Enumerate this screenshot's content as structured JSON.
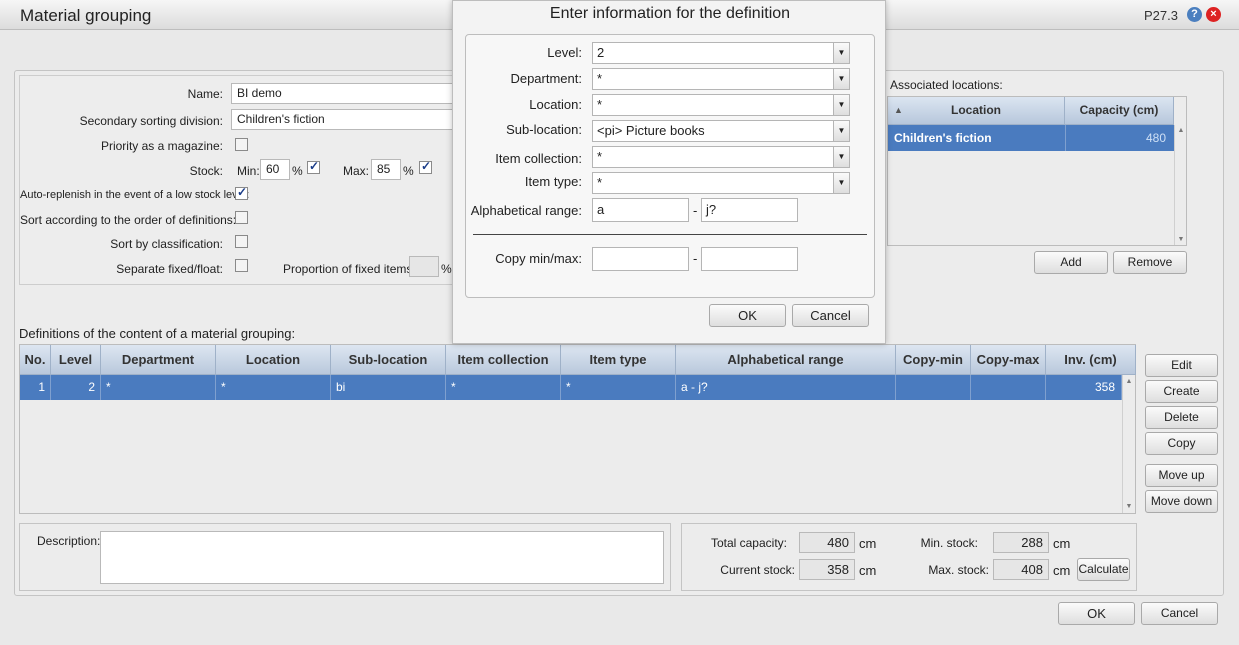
{
  "window": {
    "title": "Material grouping",
    "version": "P27.3",
    "help": "?",
    "close": "×"
  },
  "form": {
    "name_label": "Name:",
    "name_value": "BI demo",
    "secondary_label": "Secondary sorting division:",
    "secondary_value": "Children's fiction",
    "priority_label": "Priority as a magazine:",
    "priority_checked": false,
    "stock_label": "Stock:",
    "min_label": "Min:",
    "min_value": "60",
    "pct1": "%",
    "min_checked": true,
    "max_label": "Max:",
    "max_value": "85",
    "pct2": "%",
    "max_checked": true,
    "autoreplenish_label": "Auto-replenish in the event of a low stock level:",
    "autoreplenish_checked": true,
    "sort_order_label": "Sort according to the order of definitions:",
    "sort_order_checked": false,
    "sort_class_label": "Sort by classification:",
    "sort_class_checked": false,
    "separate_label": "Separate fixed/float:",
    "separate_checked": false,
    "proportion_label": "Proportion of fixed items:",
    "proportion_value": "",
    "pct3": "%"
  },
  "locations": {
    "label": "Associated locations:",
    "columns": [
      "Location",
      "Capacity (cm)"
    ],
    "rows": [
      {
        "location": "Children's fiction",
        "capacity": "480"
      }
    ],
    "add_label": "Add",
    "remove_label": "Remove"
  },
  "definitions": {
    "label": "Definitions of the content of a material grouping:",
    "columns": [
      "No.",
      "Level",
      "Department",
      "Location",
      "Sub-location",
      "Item collection",
      "Item type",
      "Alphabetical range",
      "Copy-min",
      "Copy-max",
      "Inv. (cm)"
    ],
    "rows": [
      {
        "no": "1",
        "level": "2",
        "department": "*",
        "location": "*",
        "sublocation": "bi",
        "collection": "*",
        "itemtype": "*",
        "range": "a - j?",
        "copymin": "",
        "copymax": "",
        "inv": "358"
      }
    ],
    "buttons": {
      "edit": "Edit",
      "create": "Create",
      "delete": "Delete",
      "copy": "Copy",
      "move_up": "Move up",
      "move_down": "Move down"
    }
  },
  "description": {
    "label": "Description:",
    "value": ""
  },
  "stock": {
    "total_capacity_label": "Total capacity:",
    "total_capacity": "480",
    "current_stock_label": "Current stock:",
    "current_stock": "358",
    "min_stock_label": "Min. stock:",
    "min_stock": "288",
    "max_stock_label": "Max. stock:",
    "max_stock": "408",
    "unit": "cm",
    "calculate_label": "Calculate"
  },
  "footer": {
    "ok": "OK",
    "cancel": "Cancel"
  },
  "dialog": {
    "title": "Enter information for the definition",
    "level_label": "Level:",
    "level_value": "2",
    "department_label": "Department:",
    "department_value": "*",
    "location_label": "Location:",
    "location_value": "*",
    "sublocation_label": "Sub-location:",
    "sublocation_value": "<pi> Picture books",
    "collection_label": "Item collection:",
    "collection_value": "*",
    "itemtype_label": "Item type:",
    "itemtype_value": "*",
    "range_label": "Alphabetical range:",
    "range_from": "a",
    "range_to": "j?",
    "dash": "-",
    "copy_label": "Copy min/max:",
    "copy_min": "",
    "copy_max": "",
    "ok": "OK",
    "cancel": "Cancel"
  },
  "colors": {
    "selection": "#4a7bbf",
    "header": "#b9c8dc"
  }
}
